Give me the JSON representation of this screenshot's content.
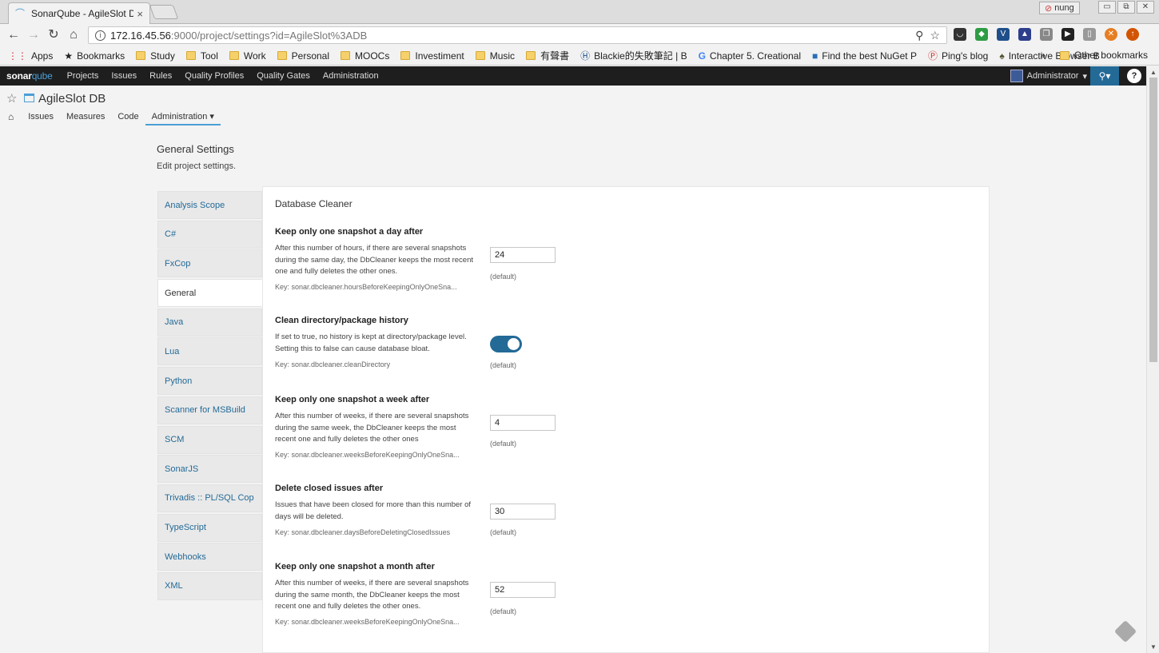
{
  "browser": {
    "tab_title": "SonarQube - AgileSlot D",
    "tab_close": "×",
    "user_label": "nung",
    "win_min": "▭",
    "win_restore": "⧉",
    "win_close": "✕",
    "url_host": "172.16.45.56",
    "url_rest": ":9000/project/settings?id=AgileSlot%3ADB",
    "bookmarks": [
      "Apps",
      "Bookmarks",
      "Study",
      "Tool",
      "Work",
      "Personal",
      "MOOCs",
      "Investiment",
      "Music",
      "有聲書",
      "Blackie的失敗筆記 | B",
      "Chapter 5. Creational",
      "Find the best NuGet P",
      "Ping's blog",
      "Interactive Browser B"
    ],
    "bookmarks_more": "»",
    "other_bookmarks": "Other bookmarks"
  },
  "sonar_nav": {
    "logo_sonar": "sonar",
    "logo_qube": "qube",
    "links": [
      "Projects",
      "Issues",
      "Rules",
      "Quality Profiles",
      "Quality Gates",
      "Administration"
    ],
    "user": "Administrator"
  },
  "project": {
    "name": "AgileSlot DB",
    "tabs": [
      "Issues",
      "Measures",
      "Code",
      "Administration"
    ]
  },
  "page": {
    "title": "General Settings",
    "subtitle": "Edit project settings."
  },
  "categories": [
    "Analysis Scope",
    "C#",
    "FxCop",
    "General",
    "Java",
    "Lua",
    "Python",
    "Scanner for MSBuild",
    "SCM",
    "SonarJS",
    "Trivadis :: PL/SQL Cop",
    "TypeScript",
    "Webhooks",
    "XML"
  ],
  "panel": {
    "title": "Database Cleaner",
    "settings": [
      {
        "name": "Keep only one snapshot a day after",
        "description": "After this number of hours, if there are several snapshots during the same day, the DbCleaner keeps the most recent one and fully deletes the other ones.",
        "key": "Key: sonar.dbcleaner.hoursBeforeKeepingOnlyOneSna...",
        "value": "24",
        "default": "(default)"
      },
      {
        "name": "Clean directory/package history",
        "description": "If set to true, no history is kept at directory/package level. Setting this to false can cause database bloat.",
        "key": "Key: sonar.dbcleaner.cleanDirectory",
        "value": "true",
        "default": "(default)"
      },
      {
        "name": "Keep only one snapshot a week after",
        "description": "After this number of weeks, if there are several snapshots during the same week, the DbCleaner keeps the most recent one and fully deletes the other ones",
        "key": "Key: sonar.dbcleaner.weeksBeforeKeepingOnlyOneSna...",
        "value": "4",
        "default": "(default)"
      },
      {
        "name": "Delete closed issues after",
        "description": "Issues that have been closed for more than this number of days will be deleted.",
        "key": "Key: sonar.dbcleaner.daysBeforeDeletingClosedIssues",
        "value": "30",
        "default": "(default)"
      },
      {
        "name": "Keep only one snapshot a month after",
        "description": "After this number of weeks, if there are several snapshots during the same month, the DbCleaner keeps the most recent one and fully deletes the other ones.",
        "key": "Key: sonar.dbcleaner.weeksBeforeKeepingOnlyOneSna...",
        "value": "52",
        "default": "(default)"
      }
    ]
  },
  "colors": {
    "accent": "#236a97",
    "nav_bg": "#1e1e1e",
    "link": "#236a97"
  }
}
